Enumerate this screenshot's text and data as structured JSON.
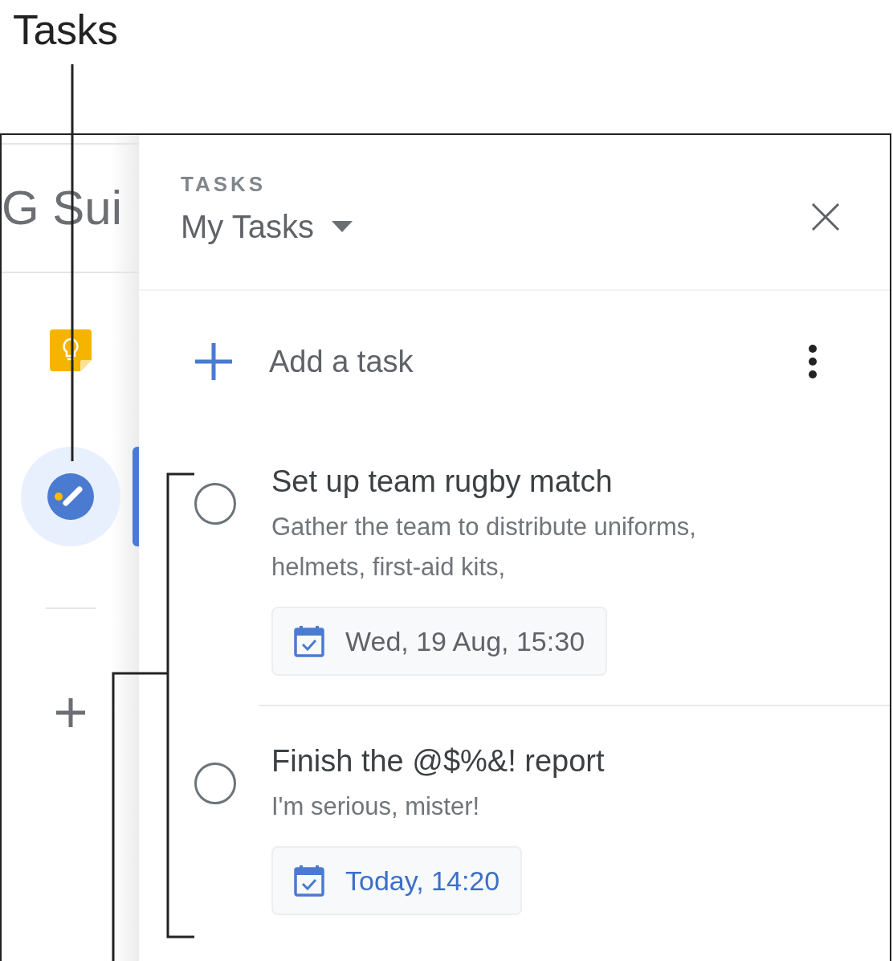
{
  "callout": {
    "label": "Tasks"
  },
  "app": {
    "logo_text": "G Sui"
  },
  "sidebar": {
    "items": [
      {
        "kind": "keep",
        "selected": false
      },
      {
        "kind": "tasks",
        "selected": true
      }
    ]
  },
  "panel": {
    "section": "TASKS",
    "list_name": "My Tasks",
    "add_label": "Add a task"
  },
  "tasks": [
    {
      "title": "Set up team rugby match",
      "notes": "Gather the team to distribute uniforms, helmets, first-aid kits,",
      "due": "Wed, 19 Aug, 15:30",
      "due_today": false,
      "completed": false
    },
    {
      "title": "Finish the @$%&! report",
      "notes": "I'm serious, mister!",
      "due": "Today, 14:20",
      "due_today": true,
      "completed": false
    }
  ]
}
